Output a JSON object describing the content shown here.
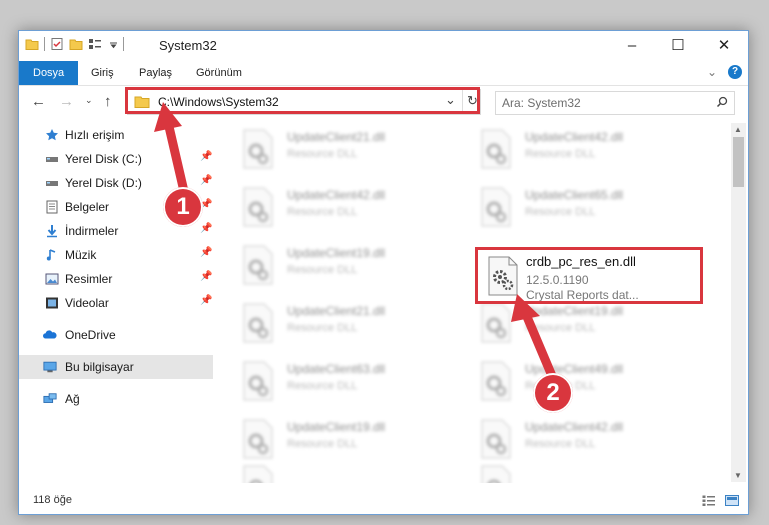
{
  "window": {
    "title": "System32"
  },
  "ribbon": {
    "tabs": [
      "Dosya",
      "Giriş",
      "Paylaş",
      "Görünüm"
    ]
  },
  "address": {
    "path": "C:\\Windows\\System32"
  },
  "search": {
    "placeholder": "Ara: System32"
  },
  "sidebar": {
    "items": [
      {
        "label": "Hızlı erişim",
        "icon": "star-icon"
      },
      {
        "label": "Yerel Disk (C:)",
        "icon": "drive-icon",
        "pinned": true
      },
      {
        "label": "Yerel Disk (D:)",
        "icon": "drive-icon",
        "pinned": true
      },
      {
        "label": "Belgeler",
        "icon": "documents-icon",
        "pinned": true
      },
      {
        "label": "İndirmeler",
        "icon": "download-icon",
        "pinned": true
      },
      {
        "label": "Müzik",
        "icon": "music-icon",
        "pinned": true
      },
      {
        "label": "Resimler",
        "icon": "pictures-icon",
        "pinned": true
      },
      {
        "label": "Videolar",
        "icon": "videos-icon",
        "pinned": true
      },
      {
        "label": "OneDrive",
        "icon": "cloud-icon"
      },
      {
        "label": "Bu bilgisayar",
        "icon": "computer-icon",
        "selected": true
      },
      {
        "label": "Ağ",
        "icon": "network-icon"
      }
    ]
  },
  "files": {
    "left": [
      {
        "name": "UpdateClient21.dll",
        "type": "Resource DLL"
      },
      {
        "name": "UpdateClient42.dll",
        "type": "Resource DLL"
      },
      {
        "name": "UpdateClient19.dll",
        "type": "Resource DLL"
      },
      {
        "name": "UpdateClient21.dll",
        "type": "Resource DLL"
      },
      {
        "name": "UpdateClient63.dll",
        "type": "Resource DLL"
      },
      {
        "name": "UpdateClient19.dll",
        "type": "Resource DLL"
      },
      {
        "name": "",
        "type": ""
      }
    ],
    "right": [
      {
        "name": "UpdateClient42.dll",
        "type": "Resource DLL"
      },
      {
        "name": "UpdateClient65.dll",
        "type": "Resource DLL"
      },
      {
        "name": "crdb_pc_res_en.dll",
        "type": "12.5.0.1190",
        "extra": "Crystal Reports dat..."
      },
      {
        "name": "UpdateClient19.dll",
        "type": "Resource DLL"
      },
      {
        "name": "UpdateClient49.dll",
        "type": "Resource DLL"
      },
      {
        "name": "UpdateClient42.dll",
        "type": "Resource DLL"
      },
      {
        "name": "",
        "type": ""
      }
    ]
  },
  "status": {
    "count": "118 öğe"
  },
  "callouts": {
    "one": "1",
    "two": "2"
  },
  "colors": {
    "accent": "#1979ca",
    "highlight": "#d9363e"
  }
}
